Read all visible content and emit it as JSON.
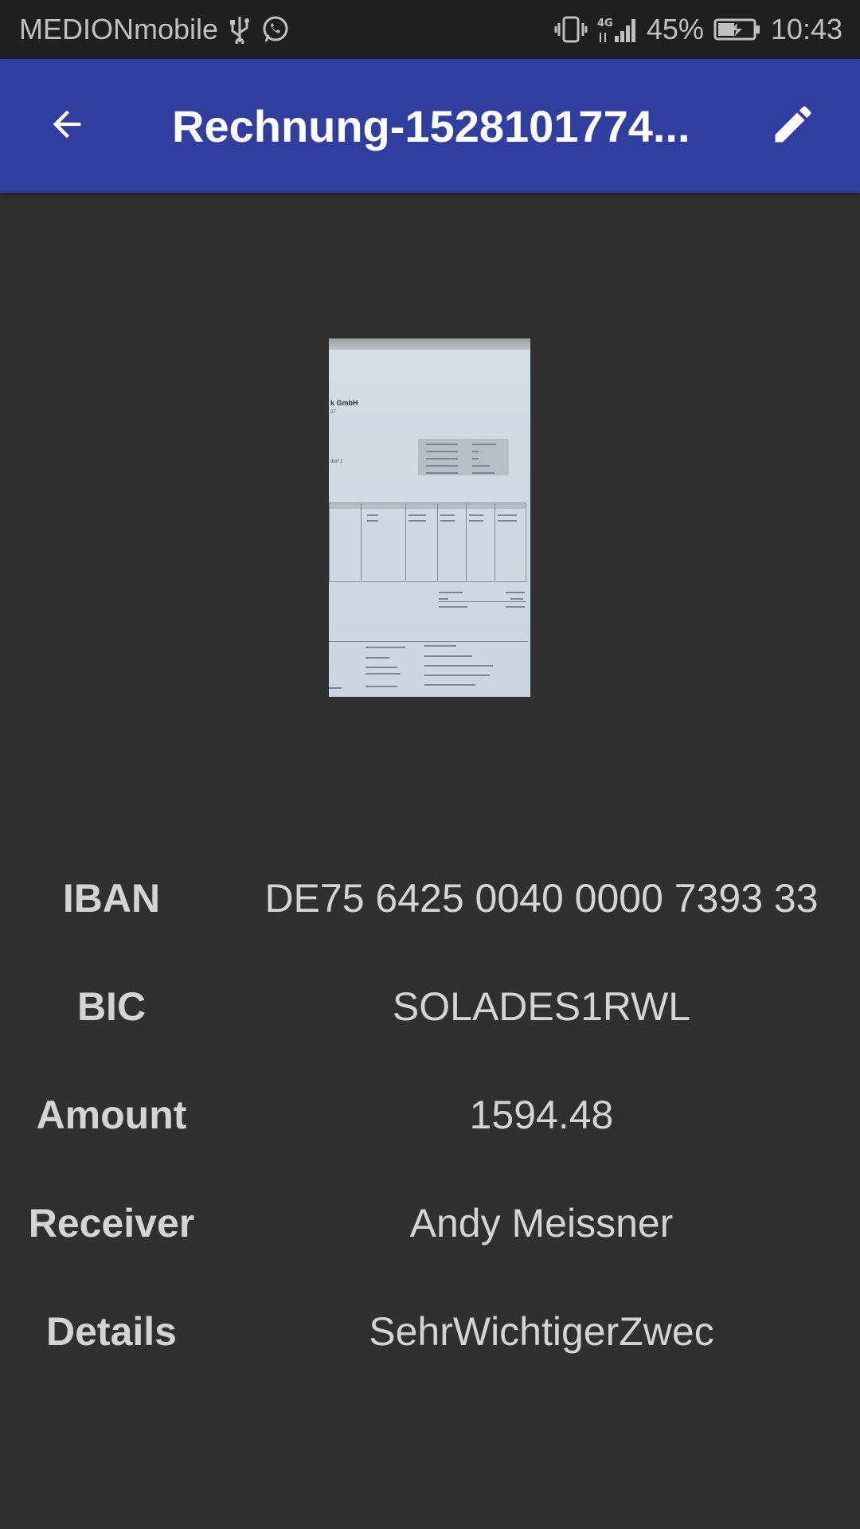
{
  "status_bar": {
    "carrier": "MEDIONmobile",
    "network": "4G",
    "battery": "45%",
    "time": "10:43",
    "icons": [
      "usb-icon",
      "whatsapp-icon",
      "vibrate-icon",
      "signal-icon",
      "battery-charging-icon"
    ]
  },
  "app_bar": {
    "title": "Rechnung-1528101774...",
    "back_icon": "arrow-back-icon",
    "edit_icon": "pencil-icon",
    "color": "#303f9f"
  },
  "preview": {
    "company": "k GmbH",
    "table_headers": [
      "nung",
      "Anzahl",
      "Einheit",
      "Preis/Einheit",
      "USt. %",
      "USt. €",
      "Gesamt"
    ],
    "summary": [
      "Nettobetrag",
      "USt.",
      "Gesamtbetrag"
    ],
    "footer": [
      "Kontaktinformationen",
      "Bankverbindung",
      "Andy Meissner",
      "Empfänger: Andy Meissner"
    ]
  },
  "fields": [
    {
      "label": "IBAN",
      "value": "DE75 6425 0040 0000 7393 33"
    },
    {
      "label": "BIC",
      "value": "SOLADES1RWL"
    },
    {
      "label": "Amount",
      "value": "1594.48"
    },
    {
      "label": "Receiver",
      "value": "Andy Meissner"
    },
    {
      "label": "Details",
      "value": "SehrWichtigerZwec"
    }
  ]
}
